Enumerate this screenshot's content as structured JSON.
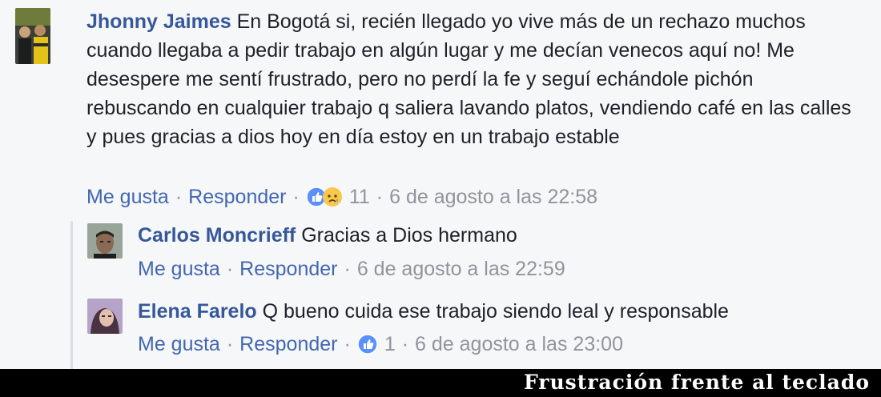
{
  "comments": [
    {
      "author": "Jhonny Jaimes",
      "text": "En Bogotá si, recién llegado yo vive más de un rechazo muchos cuando llegaba a pedir trabajo en algún lugar y me decían venecos aquí no! Me desespere me sentí frustrado, pero no perdí la fe y seguí echándole pichón rebuscando en cualquier trabajo q saliera lavando platos, vendiendo café en las calles y pues gracias a dios hoy en día estoy en un trabajo estable",
      "like_label": "Me gusta",
      "reply_label": "Responder",
      "reaction_icons": [
        "like-icon",
        "sad-icon"
      ],
      "reaction_count": "11",
      "timestamp": "6 de agosto a las 22:58"
    }
  ],
  "replies": [
    {
      "author": "Carlos Moncrieff",
      "text": "Gracias a Dios hermano",
      "like_label": "Me gusta",
      "reply_label": "Responder",
      "timestamp": "6 de agosto a las 22:59"
    },
    {
      "author": "Elena Farelo",
      "text": "Q bueno cuida ese trabajo siendo leal y responsable",
      "like_label": "Me gusta",
      "reply_label": "Responder",
      "reaction_icons": [
        "like-icon"
      ],
      "reaction_count": "1",
      "timestamp": "6 de agosto a las 23:00"
    }
  ],
  "caption": "Frustración frente al teclado",
  "colors": {
    "author": "#365899",
    "link": "#4267b2",
    "meta": "#90949c",
    "background": "#f6f7f9",
    "like_blue": "#5890ff",
    "sad_yellow": "#f7c84b"
  }
}
